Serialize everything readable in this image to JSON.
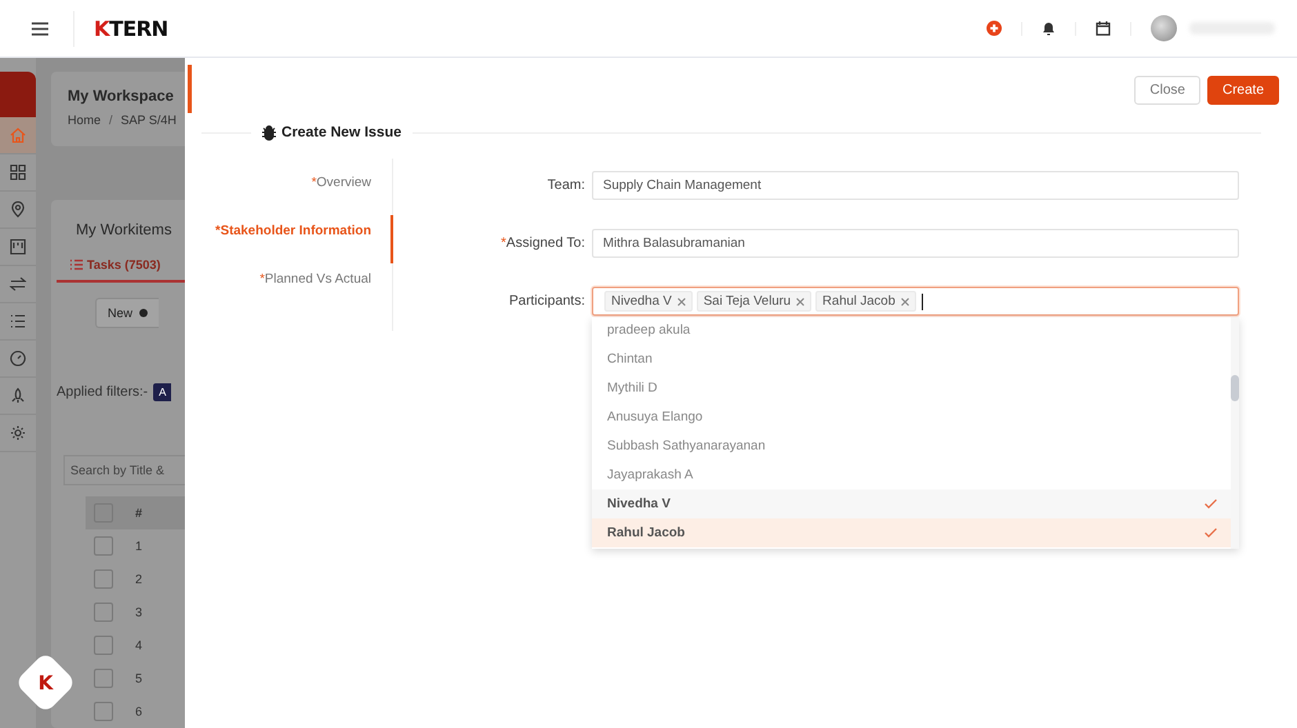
{
  "header": {
    "logo_mark": "K",
    "logo_text": "TERN"
  },
  "background": {
    "workspace_title": "My Workspace",
    "breadcrumb": [
      "Home",
      "/",
      "SAP S/4H"
    ],
    "nav": [
      {
        "selected": true
      },
      {
        "selected": false
      },
      {
        "selected": false
      },
      {
        "selected": false
      },
      {
        "selected": false
      },
      {
        "selected": false
      },
      {
        "selected": false
      },
      {
        "selected": false
      },
      {
        "selected": false
      }
    ],
    "fab_mark": "K",
    "header_checked": false,
    "workitems_title": "My Workitems",
    "tab": "Tasks (7503)",
    "new_button": "New",
    "filters_label": "Applied filters:-",
    "filter_badge": "A",
    "search_placeholder": "Search by Title & ",
    "table_header": "#",
    "rows": [
      {
        "number": "1",
        "checked": false
      },
      {
        "number": "2",
        "checked": false
      },
      {
        "number": "3",
        "checked": false
      },
      {
        "number": "4",
        "checked": false
      },
      {
        "number": "5",
        "checked": false
      },
      {
        "number": "6",
        "checked": false
      }
    ]
  },
  "drawer": {
    "close_button": "Close",
    "create_button": "Create",
    "title": "Create New Issue",
    "required_mark": "*",
    "steps": [
      {
        "label": "Overview",
        "required": true,
        "selected": false
      },
      {
        "label": "Stakeholder Information",
        "required": true,
        "selected": true
      },
      {
        "label": "Planned Vs Actual",
        "required": true,
        "selected": false
      }
    ],
    "fields": [
      {
        "label": "Team:",
        "required": false,
        "kind": "text",
        "value": "Supply Chain Management"
      },
      {
        "label": "Assigned To:",
        "required": true,
        "kind": "text",
        "value": "Mithra Balasubramanian"
      },
      {
        "label": "Participants:",
        "required": false,
        "kind": "tags",
        "focused": true,
        "tags": [
          "Nivedha V",
          "Sai Teja Veluru",
          "Rahul Jacob"
        ]
      }
    ],
    "options": [
      {
        "label": "pradeep akula",
        "selected": false,
        "active": false
      },
      {
        "label": "Chintan",
        "selected": false,
        "active": false
      },
      {
        "label": "Mythili D",
        "selected": false,
        "active": false
      },
      {
        "label": "Anusuya Elango",
        "selected": false,
        "active": false
      },
      {
        "label": "Subbash Sathyanarayanan",
        "selected": false,
        "active": false
      },
      {
        "label": "Jayaprakash A",
        "selected": false,
        "active": false
      },
      {
        "label": "Nivedha V",
        "selected": true,
        "active": false
      },
      {
        "label": "Rahul Jacob",
        "selected": true,
        "active": true
      }
    ]
  }
}
